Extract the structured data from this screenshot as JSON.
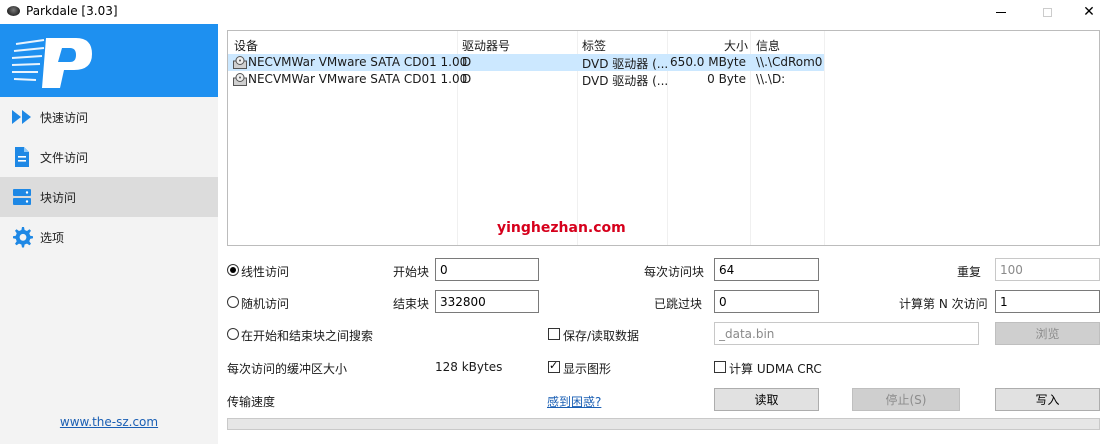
{
  "window": {
    "title": "Parkdale [3.03]",
    "minimize_glyph": "",
    "close_glyph": "✕"
  },
  "sidebar": {
    "items": [
      {
        "label": "快速访问",
        "icon": "fast-forward-icon"
      },
      {
        "label": "文件访问",
        "icon": "document-icon"
      },
      {
        "label": "块访问",
        "icon": "storage-blocks-icon"
      },
      {
        "label": "选项",
        "icon": "gear-icon"
      }
    ],
    "active_index": 2,
    "site_link": "www.the-sz.com"
  },
  "device_list": {
    "columns": [
      "设备",
      "驱动器号",
      "标签",
      "大小",
      "信息"
    ],
    "rows": [
      {
        "device": "NECVMWar VMware SATA CD01 1.00",
        "drive": "D",
        "label": "DVD 驱动器 (...",
        "size": "650.0 MByte",
        "info": "\\\\.\\CdRom0",
        "selected": true
      },
      {
        "device": "NECVMWar VMware SATA CD01 1.00",
        "drive": "D",
        "label": "DVD 驱动器 (...",
        "size": "0 Byte",
        "info": "\\\\.\\D:",
        "selected": false
      }
    ]
  },
  "watermark": "yinghezhan.com",
  "options": {
    "linear_access": "线性访问",
    "random_access": "随机访问",
    "between_search": "在开始和结束块之间搜索",
    "start_block_label": "开始块",
    "start_block_value": "0",
    "end_block_label": "结束块",
    "end_block_value": "332800",
    "blocks_per_access_label": "每次访问块",
    "blocks_per_access_value": "64",
    "skipped_blocks_label": "已跳过块",
    "skipped_blocks_value": "0",
    "repeat_label": "重复",
    "repeat_value": "100",
    "nth_access_label": "计算第 N 次访问",
    "nth_access_value": "1",
    "save_read_data_label": "保存/读取数据",
    "save_read_data_checked": false,
    "data_file_value": "_data.bin",
    "browse_label": "浏览",
    "buffer_size_label": "每次访问的缓冲区大小",
    "buffer_size_value": "128 kBytes",
    "show_graph_label": "显示图形",
    "show_graph_checked": true,
    "udma_crc_label": "计算 UDMA CRC",
    "udma_crc_checked": false,
    "transfer_speed_label": "传输速度",
    "help_link": "感到困惑?",
    "read_button": "读取",
    "stop_button": "停止(S)",
    "write_button": "写入",
    "progress": 0.0
  },
  "colors": {
    "logo_bg": "#1e90f0",
    "selection": "#cce8ff",
    "accent_link": "#1a5fb4"
  }
}
